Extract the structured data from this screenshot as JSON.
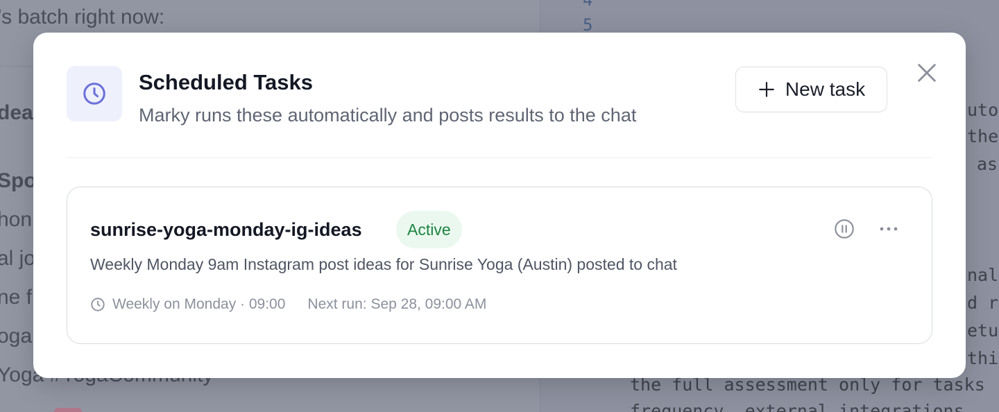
{
  "background": {
    "left_texts": [
      "’s batch right now:",
      "dea",
      "Spo",
      "hon",
      "al jo",
      "ne f",
      "oga",
      "Yoga #YogaCommunity"
    ],
    "line_numbers": [
      "4",
      "5"
    ],
    "right_code": [
      "uto",
      "the",
      "as",
      "nal",
      "d r",
      "etu",
      "thi",
      "the full assessment only for tasks",
      "frequency, external integrations"
    ]
  },
  "modal": {
    "title": "Scheduled Tasks",
    "subtitle": "Marky runs these automatically and posts results to the chat",
    "header_icon": "clock-icon",
    "new_task_label": "New task",
    "new_task_icon": "plus-icon",
    "close_icon": "close-icon"
  },
  "tasks": [
    {
      "name": "sunrise-yoga-monday-ig-ideas",
      "status": "Active",
      "description": "Weekly Monday 9am Instagram post ideas for Sunrise Yoga (Austin) posted to chat",
      "schedule": "Weekly on Monday · 09:00",
      "next_run": "Next run: Sep 28, 09:00 AM",
      "pause_icon": "pause-icon",
      "more_icon": "more-horizontal-icon"
    }
  ],
  "colors": {
    "accent": "#6b6fd8",
    "accent_bg": "#eef0fc",
    "status_bg": "#ebf8ef",
    "status_text": "#1d8442",
    "overlay": "#8c91a0"
  }
}
